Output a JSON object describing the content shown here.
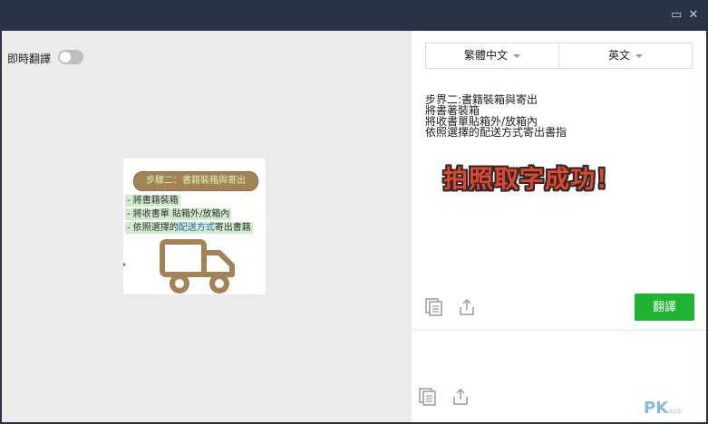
{
  "window": {
    "maximize_icon": "maximize-icon",
    "close_icon": "close-icon",
    "maximize_glyph": "▭",
    "close_glyph": "✕"
  },
  "left": {
    "live_translate_label": "即時翻譯",
    "live_translate_on": false,
    "preview": {
      "title": "步驟二：書籍裝箱與寄出",
      "lines": [
        "- 將書籍裝箱",
        "- 將收書單 貼箱外/放箱內",
        "- 依照選擇的",
        "配送方式",
        "寄出書籍"
      ],
      "truck_icon": "truck-icon",
      "accent_color": "#a38355"
    }
  },
  "right": {
    "source_language": "繁體中文",
    "target_language": "英文",
    "ocr_lines": [
      "步界二:書籍裝箱與寄出",
      "將書著裝箱",
      "將收書單貼箱外/放箱內",
      "依照選擇的配送方式寄出書指"
    ],
    "annotation": "拍照取字成功！",
    "copy_icon": "copy-icon",
    "share_icon": "share-icon",
    "translate_button": "翻譯",
    "translate_color": "#1fb432"
  },
  "watermark": {
    "text": "PK",
    "sub": "app"
  }
}
